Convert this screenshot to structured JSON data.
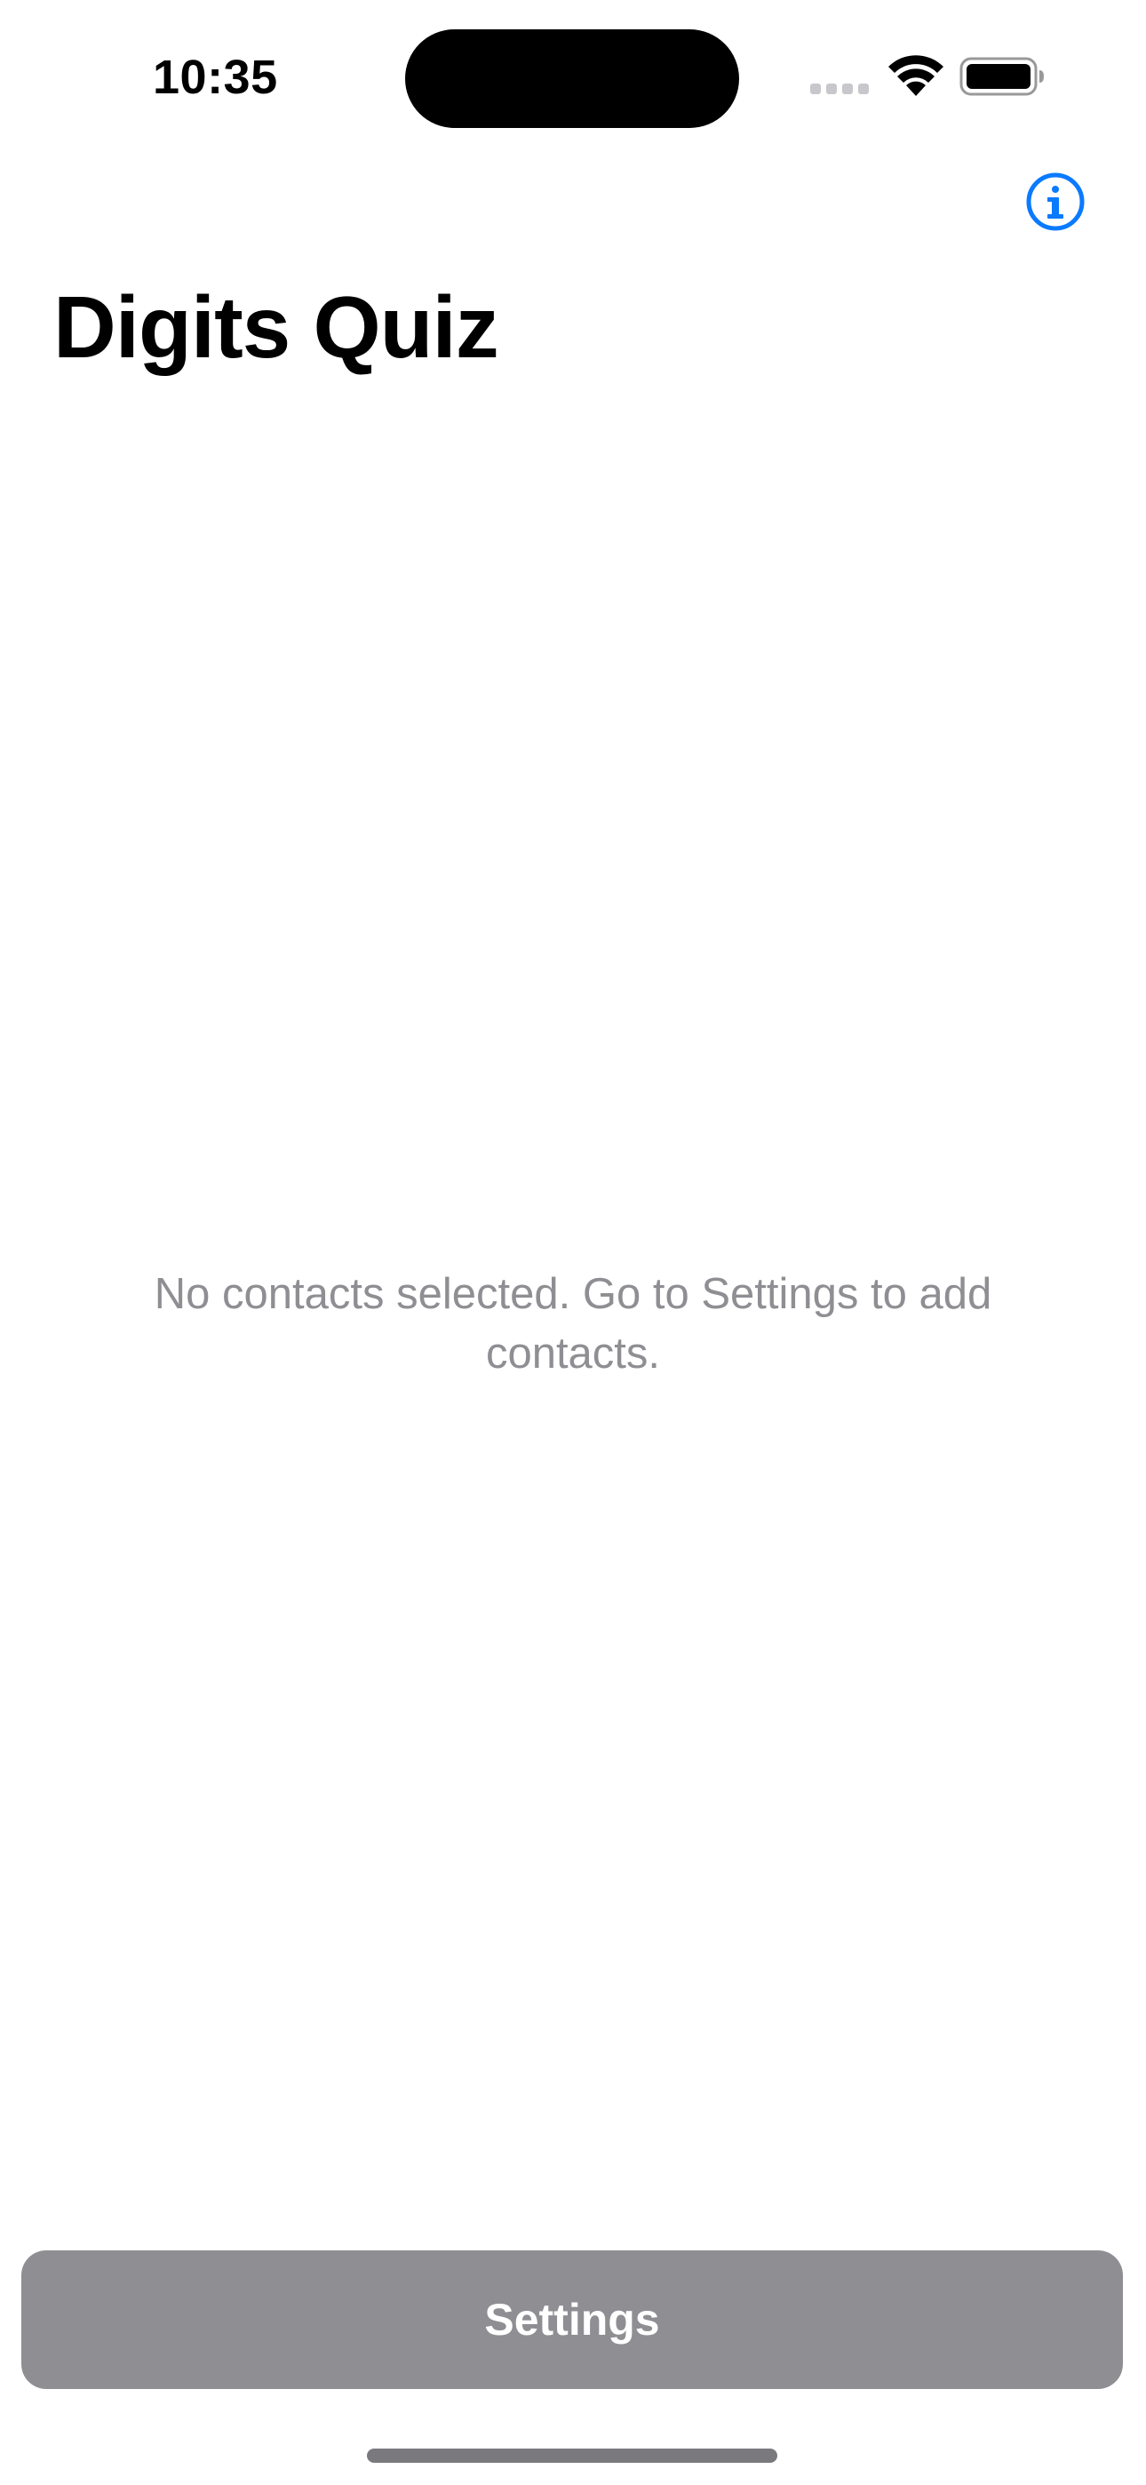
{
  "status_bar": {
    "time": "10:35"
  },
  "nav": {
    "title": "Digits Quiz",
    "info_icon": "info-circle-icon"
  },
  "empty_state": {
    "message": "No contacts selected. Go to Settings to add contacts."
  },
  "footer": {
    "settings_label": "Settings"
  },
  "colors": {
    "accent": "#0a7aff",
    "secondary_text": "#8e8e93",
    "button_background": "#8e8e93",
    "button_text": "#ffffff"
  }
}
